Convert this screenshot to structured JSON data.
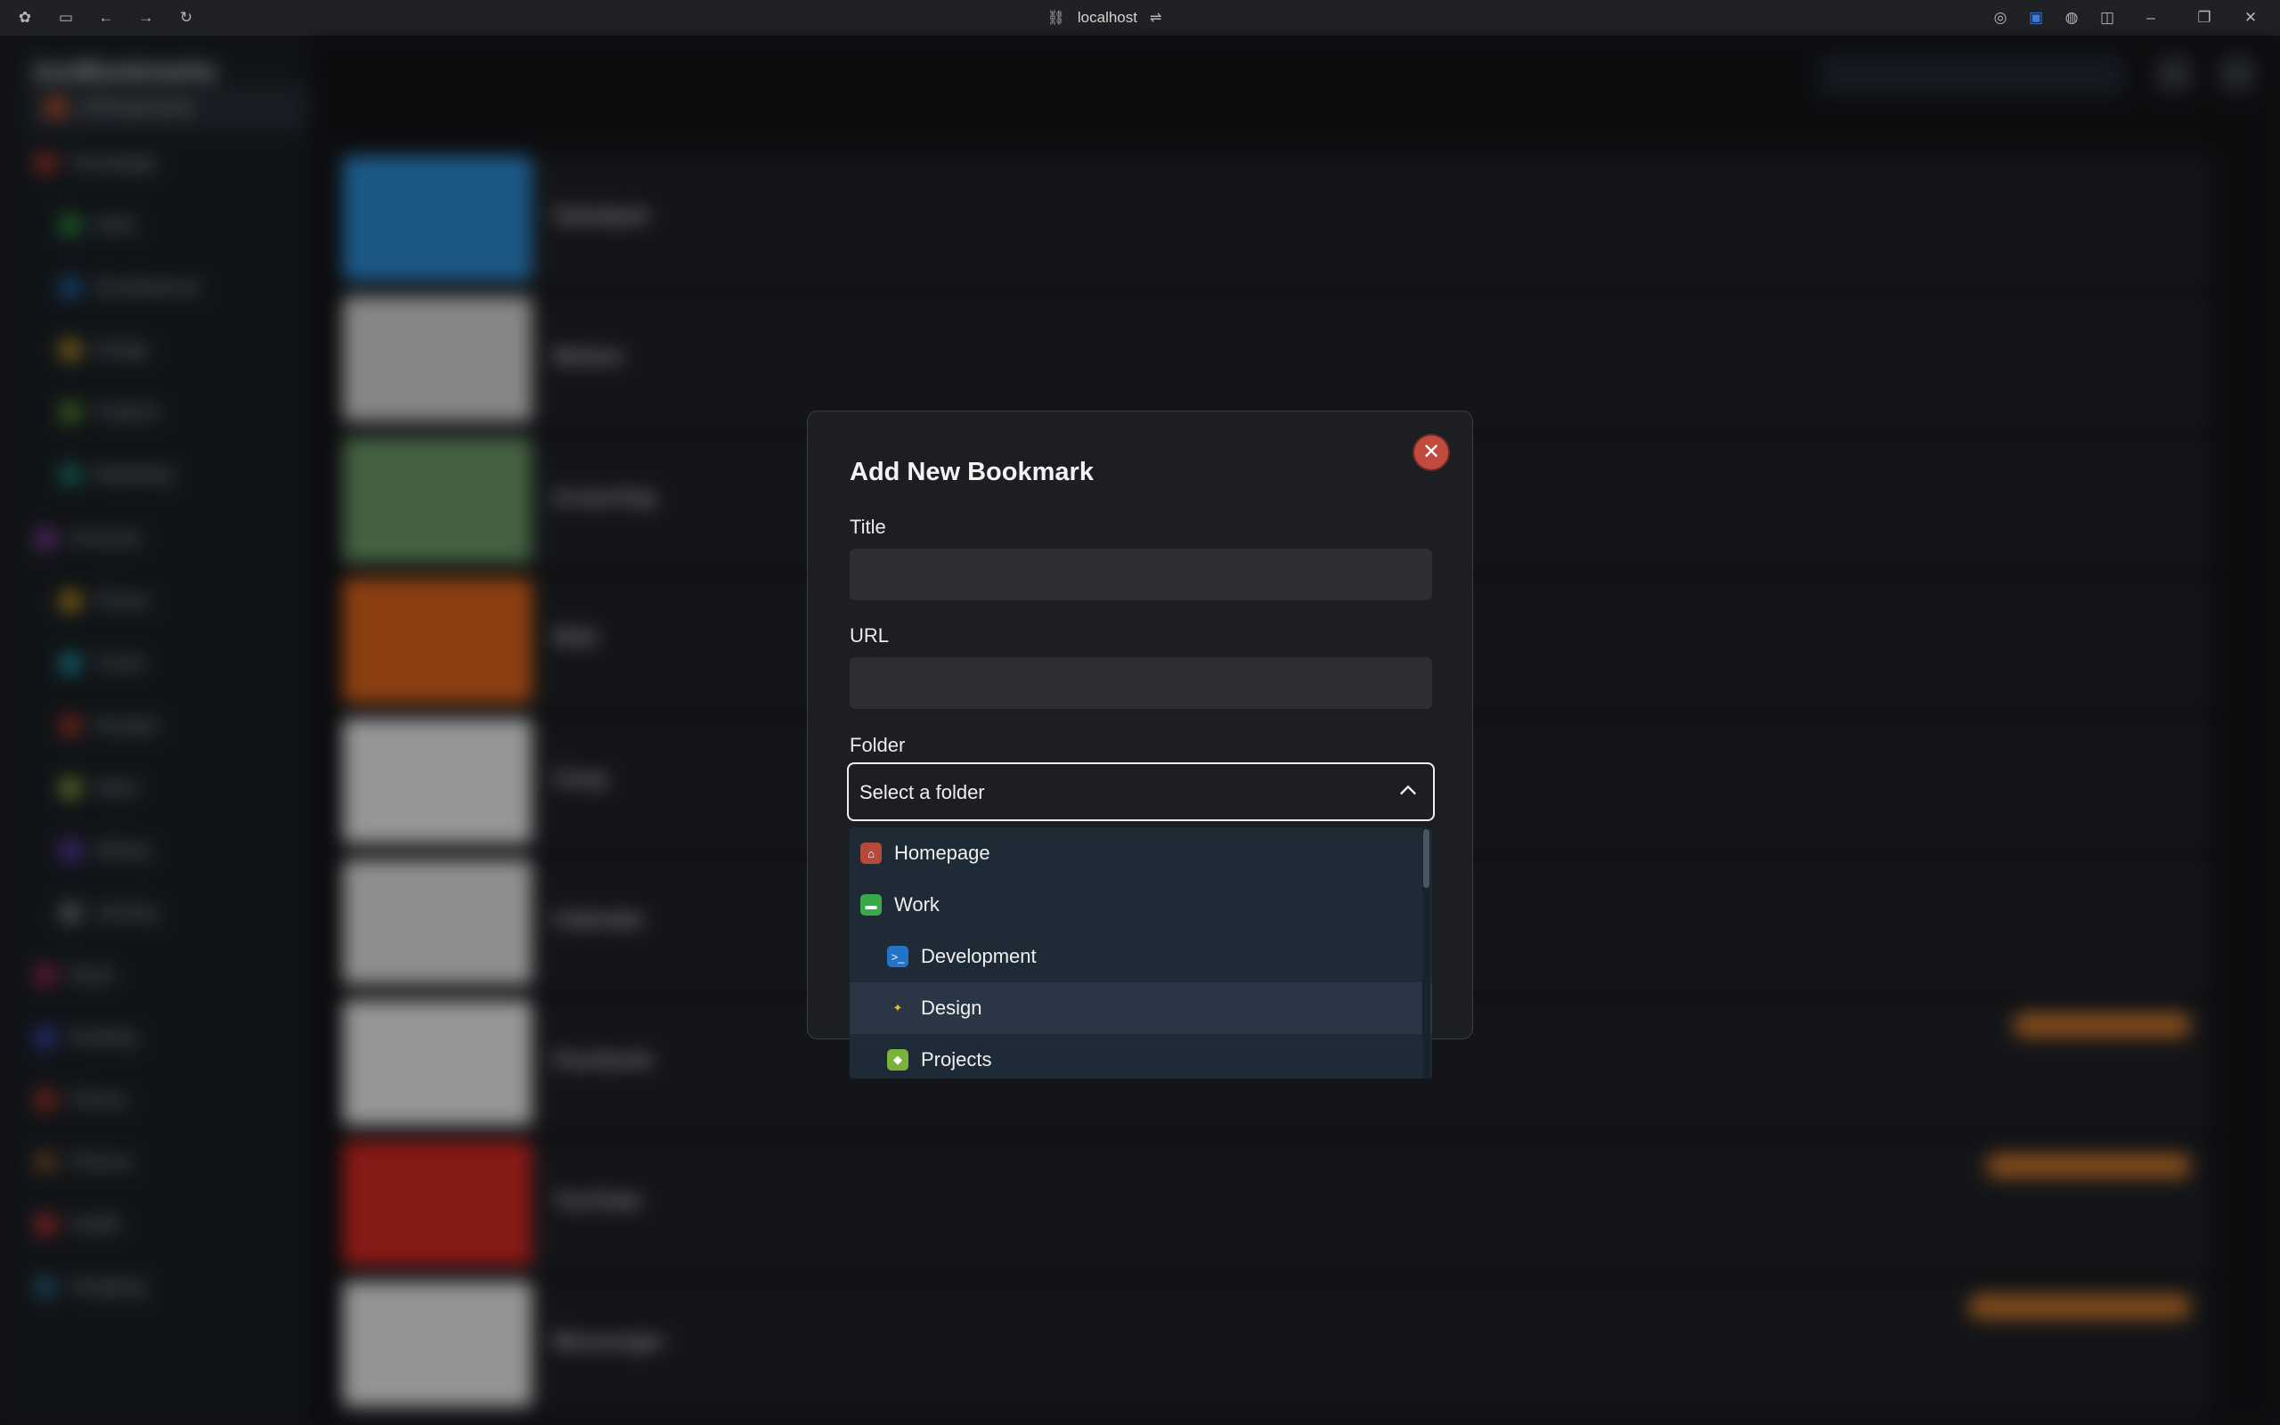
{
  "browser": {
    "url": "localhost"
  },
  "app": {
    "brand": "JustBookmarks",
    "sidebar_items": [
      {
        "label": "All Bookmarks",
        "color": "#d9562b"
      },
      {
        "label": "Homepage",
        "color": "#c0392b"
      },
      {
        "label": "Work",
        "color": "#2ea043"
      },
      {
        "label": "Development",
        "color": "#1f6fb5"
      },
      {
        "label": "Design",
        "color": "#c9a227"
      },
      {
        "label": "Projects",
        "color": "#5a9b2f"
      },
      {
        "label": "Marketing",
        "color": "#1a8f7a"
      },
      {
        "label": "Personal",
        "color": "#8e3fa8"
      },
      {
        "label": "Photos",
        "color": "#d4a017"
      },
      {
        "label": "Travel",
        "color": "#1ea5b5"
      },
      {
        "label": "Recipes",
        "color": "#c0392b"
      },
      {
        "label": "Ideas",
        "color": "#9bb43a"
      },
      {
        "label": "Writing",
        "color": "#6a3fc9"
      },
      {
        "label": "Gaming",
        "color": "#7a8088"
      },
      {
        "label": "Music",
        "color": "#b02a58"
      },
      {
        "label": "Reading",
        "color": "#3b4fc4"
      },
      {
        "label": "Fitness",
        "color": "#c0392b"
      },
      {
        "label": "Finance",
        "color": "#8a5a2b"
      },
      {
        "label": "Health",
        "color": "#d93636"
      },
      {
        "label": "Shopping",
        "color": "#2a6f8a"
      }
    ],
    "bookmarks": [
      {
        "title": "Sahelpeb",
        "thumb": "#2e8fd6"
      },
      {
        "title": "Motion",
        "thumb": "#d9d9d9"
      },
      {
        "title": "eLearning",
        "thumb": "#6f9c6a"
      },
      {
        "title": "RSS",
        "thumb": "#e2671c"
      },
      {
        "title": "Coop",
        "thumb": "#f2f2f2"
      },
      {
        "title": "Calendar",
        "thumb": "#e6e6e6"
      },
      {
        "title": "Facebook",
        "thumb": "#f2f2f2"
      },
      {
        "title": "YouTube",
        "thumb": "#d92a23"
      },
      {
        "title": "Messenger",
        "thumb": "#efefef"
      }
    ]
  },
  "modal": {
    "title": "Add New Bookmark",
    "close_symbol": "✕",
    "title_label": "Title",
    "title_value": "",
    "url_label": "URL",
    "url_value": "",
    "folder_label": "Folder",
    "folder_placeholder": "Select a folder",
    "folder_options": [
      {
        "label": "Homepage",
        "icon": "house-icon",
        "color": "#b64a3a"
      },
      {
        "label": "Work",
        "icon": "briefcase-icon",
        "color": "#3ba84a"
      },
      {
        "label": "Development",
        "icon": "terminal-icon",
        "color": "#2473c6"
      },
      {
        "label": "Design",
        "icon": "design-icon",
        "color": "#e8c21a"
      },
      {
        "label": "Projects",
        "icon": "cube-icon",
        "color": "#7bb23a"
      }
    ]
  }
}
